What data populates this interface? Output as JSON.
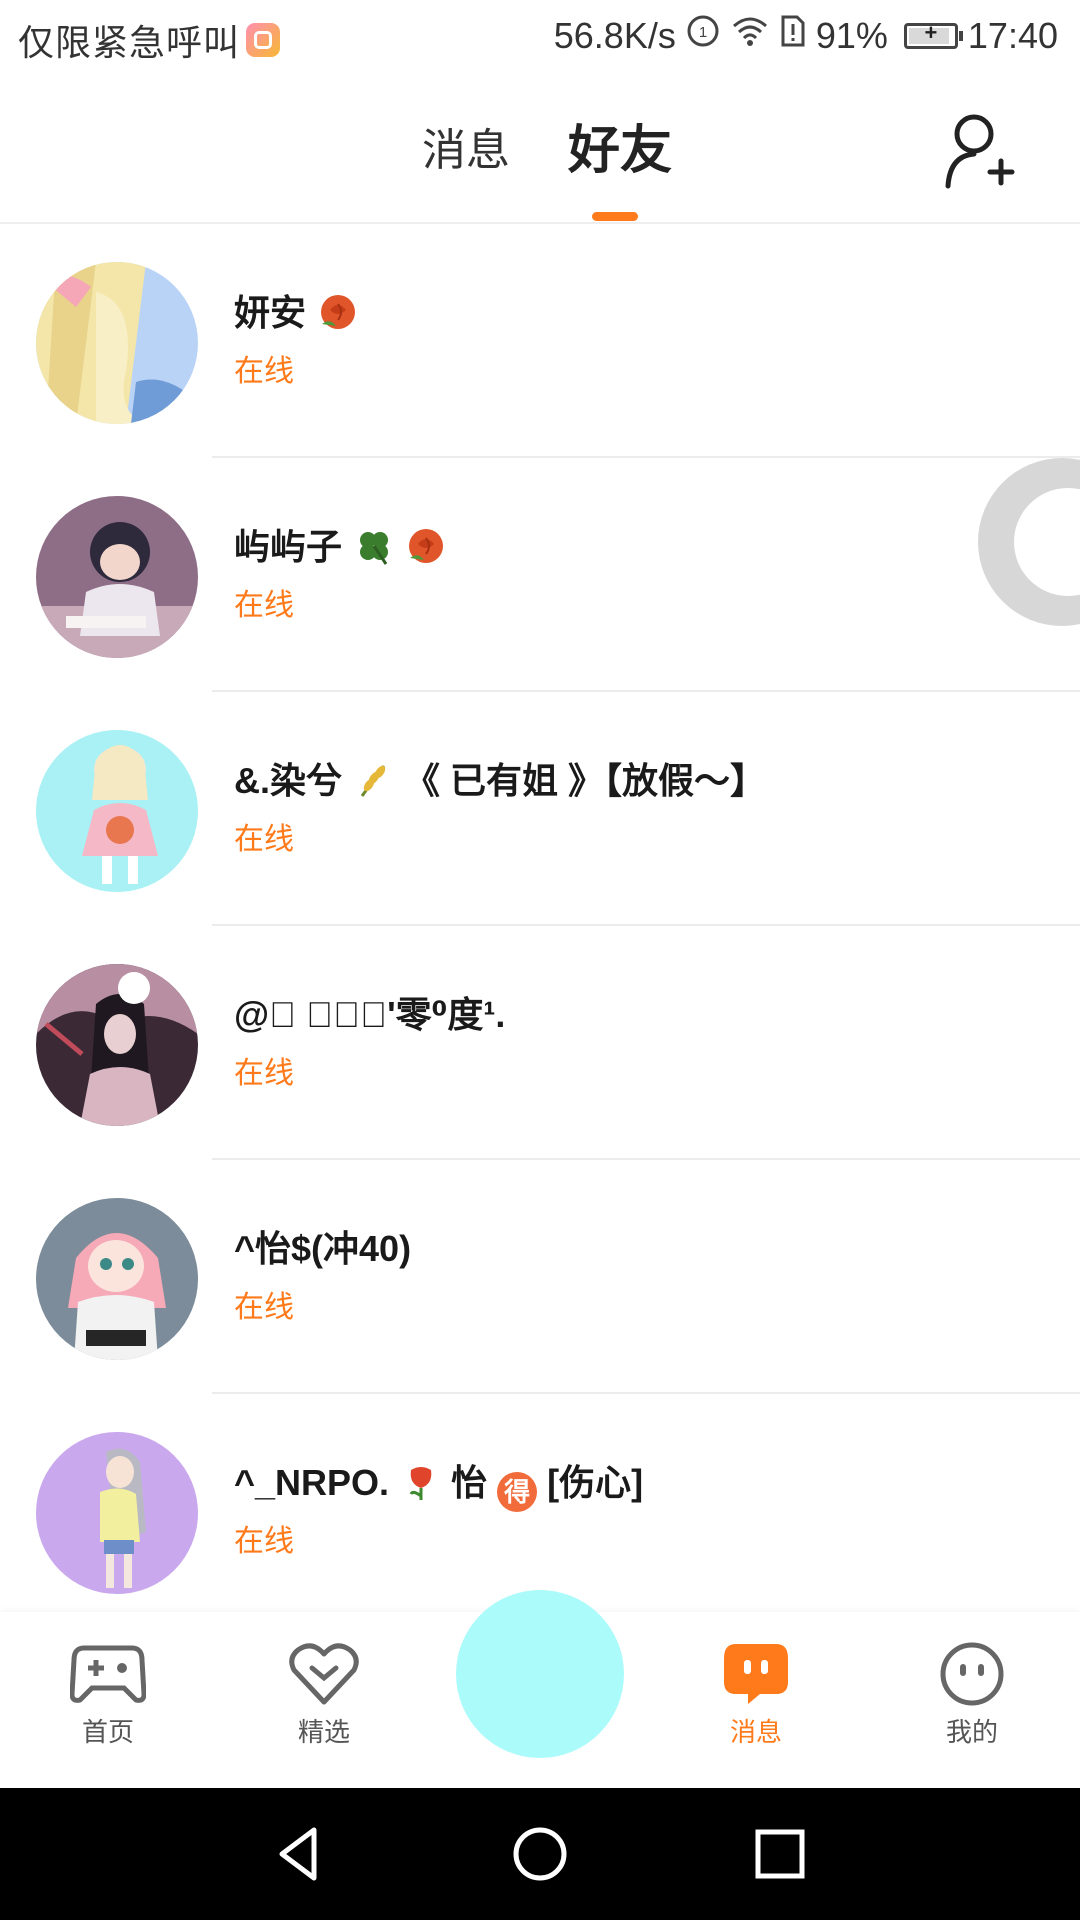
{
  "status_bar": {
    "carrier": "仅限紧急呼叫",
    "speed": "56.8K/s",
    "battery": "91%",
    "battery_level": 0.91,
    "time": "17:40"
  },
  "header": {
    "tabs": [
      {
        "label": "消息",
        "active": false
      },
      {
        "label": "好友",
        "active": true
      }
    ],
    "accent_color": "#ff7a1a"
  },
  "friends": [
    {
      "name": "妍安",
      "emojis": [
        "rose"
      ],
      "status": "在线"
    },
    {
      "name": "屿屿子",
      "emojis": [
        "clover",
        "rose"
      ],
      "status": "在线"
    },
    {
      "name": "&.染兮",
      "emojis": [
        "wheat"
      ],
      "name_suffix": "《 已有姐 》【放假～】",
      "status": "在线"
    },
    {
      "name": "@\u0000 \u0000\u0000\u0000'零⁰度¹.",
      "status": "在线"
    },
    {
      "name": "^怡$(冲40)",
      "status": "在线"
    },
    {
      "name": "^_NRPO.",
      "emojis": [
        "tulip"
      ],
      "name_suffix": "怡",
      "badge": "得",
      "name_tail": "[伤心]",
      "status": "在线"
    }
  ],
  "bottom_nav": {
    "items": [
      {
        "label": "首页",
        "icon": "gamepad-icon"
      },
      {
        "label": "精选",
        "icon": "heart-chevron-icon"
      },
      {
        "label": "消息",
        "icon": "chat-bubble-icon",
        "active": true
      },
      {
        "label": "我的",
        "icon": "face-icon"
      }
    ],
    "center_button_color": "#abfbfb"
  }
}
